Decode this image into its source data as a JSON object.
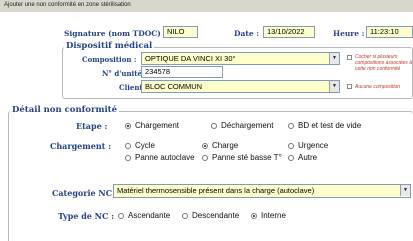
{
  "window": {
    "title": "Ajouter une non conformité en zone stérilisation"
  },
  "header": {
    "signature_label": "Signature (nom TDOC) :",
    "signature_value": "NILO",
    "date_label": "Date :",
    "date_value": "13/10/2022",
    "heure_label": "Heure :",
    "heure_value": "11:23:10"
  },
  "dispositif": {
    "legend": "Dispositif médical",
    "composition_label": "Composition :",
    "composition_value": "OPTIQUE DA VINCI XI 30°",
    "unite_label": "N° d'unité :",
    "unite_value": "234578",
    "client_label": "Client :",
    "client_value": "BLOC COMMUN",
    "cocher_note": "Cocher si plusieurs compositions associées à cette non conformité",
    "aucune_note": "Aucune composition"
  },
  "detail": {
    "legend": "Détail non conformité",
    "etape_label": "Etape :",
    "etape_options": [
      "Chargement",
      "Déchargement",
      "BD et test de vide"
    ],
    "chargement_label": "Chargement :",
    "chargement_options_row1": [
      "Cycle",
      "Charge",
      "Urgence"
    ],
    "chargement_options_row2": [
      "Panne autoclave",
      "Panne sté basse T°",
      "Autre"
    ],
    "categorie_label": "Categorie NC :",
    "categorie_value": "Matériel thermosensible présent dans la charge (autoclave)",
    "type_label": "Type de NC :",
    "type_options": [
      "Ascendante",
      "Descendante",
      "Interne"
    ]
  }
}
